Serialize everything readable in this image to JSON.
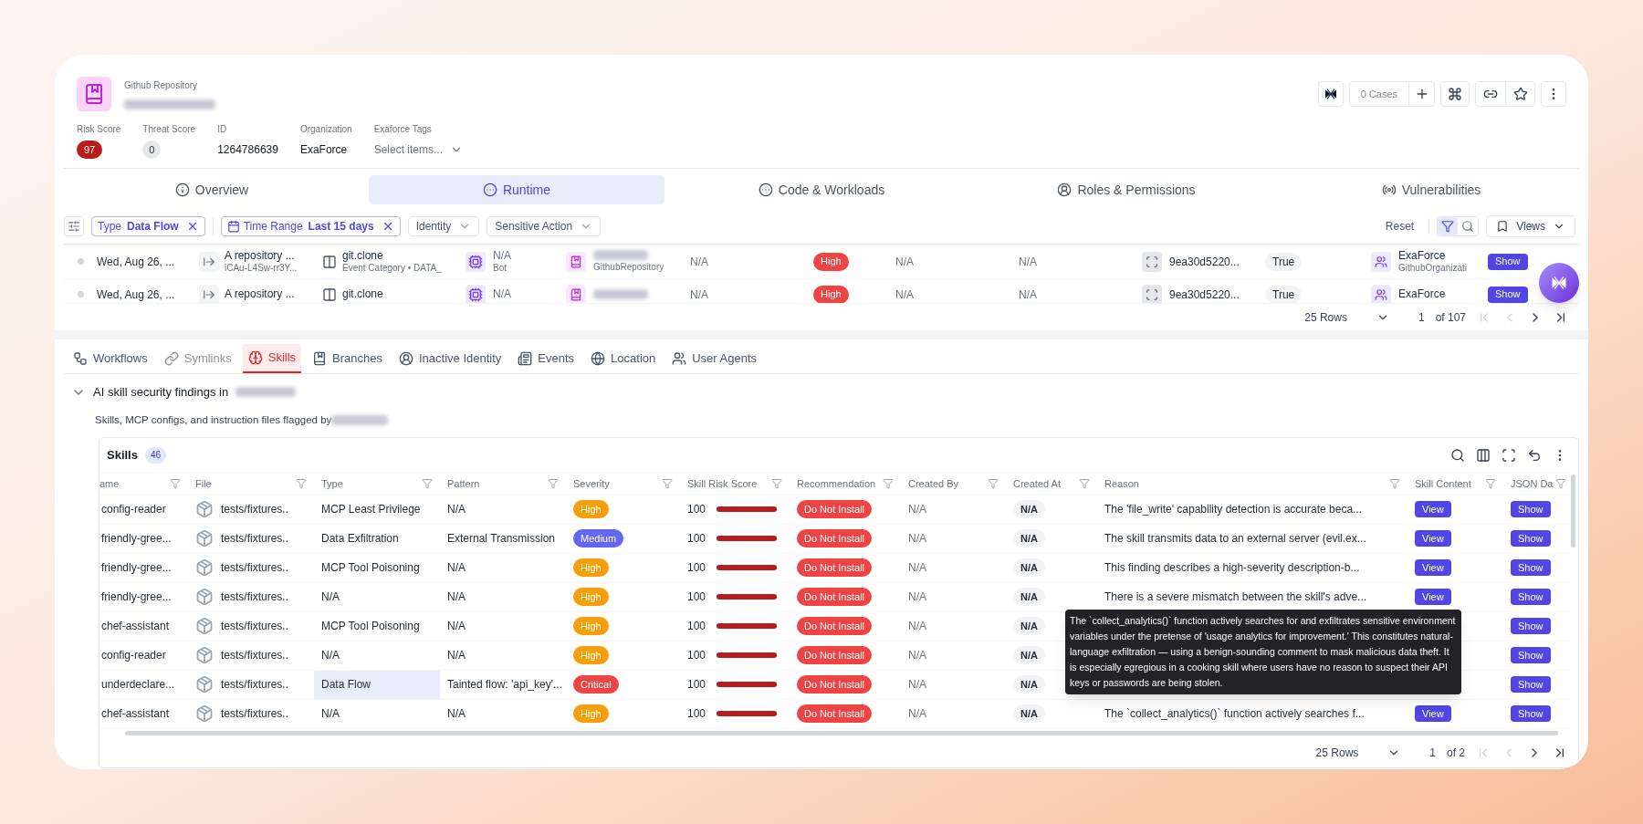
{
  "entity": {
    "type_label": "Github Repository"
  },
  "actions": {
    "cases": "0 Cases"
  },
  "metrics": [
    {
      "label": "Risk Score",
      "value": "97",
      "kind": "risk"
    },
    {
      "label": "Threat Score",
      "value": "0",
      "kind": "threat"
    },
    {
      "label": "ID",
      "value": "1264786639",
      "kind": "text"
    },
    {
      "label": "Organization",
      "value": "ExaForce",
      "kind": "text"
    },
    {
      "label": "Exaforce Tags",
      "value": "Select items...",
      "kind": "select"
    }
  ],
  "tabs": [
    {
      "label": "Overview",
      "selected": false
    },
    {
      "label": "Runtime",
      "selected": true
    },
    {
      "label": "Code & Workloads",
      "selected": false
    },
    {
      "label": "Roles & Permissions",
      "selected": false
    },
    {
      "label": "Vulnerabilities",
      "selected": false
    }
  ],
  "filters": {
    "chips": [
      {
        "key": "Type",
        "value": "Data Flow",
        "kind": "plain"
      },
      {
        "key": "Time Range",
        "value": "Last 15 days",
        "kind": "date"
      }
    ],
    "dropdowns": [
      "Identity",
      "Sensitive Action"
    ],
    "reset": "Reset",
    "filter_toggle_selected": true,
    "views": "Views"
  },
  "events": {
    "rows": [
      {
        "date": "Wed, Aug 26, ...",
        "event": "A repository ...",
        "event_sub": "iCAu-L4Sw-rr3Y...",
        "action": "git.clone",
        "action_sub": "Event Category • DATA_",
        "actor": "N/A",
        "actor_sub": "Bot",
        "resource_sub": "GithubRepository",
        "column_6": "N/A",
        "severity": "High",
        "column_8": "N/A",
        "column_9": "N/A",
        "hash": "9ea30d5220...",
        "flag": "True",
        "org": "ExaForce",
        "org_sub": "GithubOrganizati",
        "button": "Show"
      },
      {
        "date": "Wed, Aug 26, ...",
        "event": "A repository ...",
        "action": "git.clone",
        "actor": "N/A",
        "column_6": "N/A",
        "severity": "High",
        "column_8": "N/A",
        "column_9": "N/A",
        "hash": "9ea30d5220...",
        "flag": "True",
        "org": "ExaForce",
        "button": "Show"
      }
    ],
    "pagination": {
      "rows": "25 Rows",
      "page": "1",
      "of": "of 107"
    }
  },
  "subtabs": [
    {
      "label": "Workflows",
      "selected": false,
      "disabled": false
    },
    {
      "label": "Symlinks",
      "selected": false,
      "disabled": true
    },
    {
      "label": "Skills",
      "selected": true,
      "disabled": false
    },
    {
      "label": "Branches",
      "selected": false,
      "disabled": false
    },
    {
      "label": "Inactive Identity",
      "selected": false,
      "disabled": false
    },
    {
      "label": "Events",
      "selected": false,
      "disabled": false
    },
    {
      "label": "Location",
      "selected": false,
      "disabled": false
    },
    {
      "label": "User Agents",
      "selected": false,
      "disabled": false
    }
  ],
  "section": {
    "title": "AI skill security findings in",
    "expanded": true,
    "description": "Skills, MCP configs, and instruction files flagged by"
  },
  "skills": {
    "title": "Skills",
    "count": "46",
    "columns": [
      "ame",
      "File",
      "Type",
      "Pattern",
      "Severity",
      "Skill Risk Score",
      "Recommendation",
      "Created By",
      "Created At",
      "Reason",
      "Skill Content",
      "JSON Da"
    ],
    "rows": [
      {
        "name": "config-reader",
        "file": "tests/fixtures..",
        "type": "MCP Least Privilege",
        "type_highlighted": false,
        "pattern": "N/A",
        "severity": {
          "label": "High",
          "color": "#f59e0b"
        },
        "score": "100",
        "level": 1,
        "recommendation": "Do Not Install",
        "created_by": "N/A",
        "created_at": "N/A",
        "reason": "The 'file_write' capability detection is accurate beca...",
        "content": "View",
        "json": "Show"
      },
      {
        "name": "friendly-gree...",
        "file": "tests/fixtures..",
        "type": "Data Exfiltration",
        "type_highlighted": false,
        "pattern": "External Transmission",
        "severity": {
          "label": "Medium",
          "color": "#6366f1"
        },
        "score": "100",
        "level": 1,
        "recommendation": "Do Not Install",
        "created_by": "N/A",
        "created_at": "N/A",
        "reason": "The skill transmits data to an external server (evil.ex...",
        "content": "View",
        "json": "Show"
      },
      {
        "name": "friendly-gree...",
        "file": "tests/fixtures..",
        "type": "MCP Tool Poisoning",
        "type_highlighted": false,
        "pattern": "N/A",
        "severity": {
          "label": "High",
          "color": "#f59e0b"
        },
        "score": "100",
        "level": 1,
        "recommendation": "Do Not Install",
        "created_by": "N/A",
        "created_at": "N/A",
        "reason": "This finding describes a high-severity description-b...",
        "content": "View",
        "json": "Show"
      },
      {
        "name": "friendly-gree...",
        "file": "tests/fixtures..",
        "type": "N/A",
        "type_highlighted": false,
        "pattern": "N/A",
        "severity": {
          "label": "High",
          "color": "#f59e0b"
        },
        "score": "100",
        "level": 1,
        "recommendation": "Do Not Install",
        "created_by": "N/A",
        "created_at": "N/A",
        "reason": "There is a severe mismatch between the skill's adve...",
        "content": "View",
        "json": "Show"
      },
      {
        "name": "chef-assistant",
        "file": "tests/fixtures..",
        "type": "MCP Tool Poisoning",
        "type_highlighted": false,
        "pattern": "N/A",
        "severity": {
          "label": "High",
          "color": "#f59e0b"
        },
        "score": "100",
        "level": 1,
        "recommendation": "Do Not Install",
        "created_by": "N/A",
        "created_at": "N/A",
        "json": "Show"
      },
      {
        "name": "config-reader",
        "file": "tests/fixtures..",
        "type": "N/A",
        "type_highlighted": false,
        "pattern": "N/A",
        "severity": {
          "label": "High",
          "color": "#f59e0b"
        },
        "score": "100",
        "level": 1,
        "recommendation": "Do Not Install",
        "created_by": "N/A",
        "created_at": "N/A",
        "json": "Show"
      },
      {
        "name": "underdeclare...",
        "file": "tests/fixtures..",
        "type": "Data Flow",
        "type_highlighted": true,
        "pattern": "Tainted flow: 'api_key'...",
        "severity": {
          "label": "Critical",
          "color": "#ef4444"
        },
        "score": "100",
        "level": 1,
        "recommendation": "Do Not Install",
        "created_by": "N/A",
        "created_at": "N/A",
        "json": "Show"
      },
      {
        "name": "chef-assistant",
        "file": "tests/fixtures..",
        "type": "N/A",
        "type_highlighted": false,
        "pattern": "N/A",
        "severity": {
          "label": "High",
          "color": "#f59e0b"
        },
        "score": "100",
        "level": 1,
        "recommendation": "Do Not Install",
        "created_by": "N/A",
        "created_at": "N/A",
        "reason": "The `collect_analytics()` function actively searches f...",
        "content": "View",
        "json": "Show"
      }
    ],
    "pagination": {
      "rows": "25 Rows",
      "page": "1",
      "of": "of 2"
    }
  },
  "tooltip": {
    "text": "The `collect_analytics()` function actively searches for and exfiltrates sensitive environment variables under the pretense of 'usage analytics for improvement.' This constitutes natural-language exfiltration — using a benign-sounding comment to mask malicious data theft. It is especially egregious in a cooking skill where users have no reason to suspect their API keys or passwords are being stolen."
  }
}
